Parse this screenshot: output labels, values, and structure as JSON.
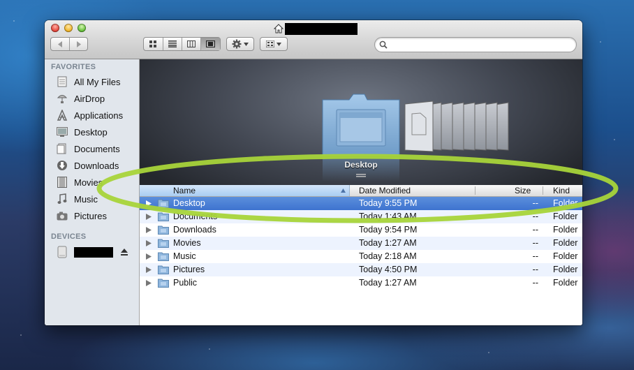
{
  "window": {
    "title": ""
  },
  "toolbar": {
    "view_icons": "icon-view-icon",
    "view_list": "list-view-icon",
    "view_columns": "column-view-icon",
    "view_coverflow": "coverflow-view-icon",
    "action_menu": "gear-icon",
    "arrange_menu": "arrange-icon"
  },
  "search": {
    "value": "",
    "placeholder": ""
  },
  "sidebar": {
    "favorites_heading": "FAVORITES",
    "favorites": [
      {
        "label": "All My Files",
        "icon": "all-files-icon"
      },
      {
        "label": "AirDrop",
        "icon": "airdrop-icon"
      },
      {
        "label": "Applications",
        "icon": "applications-icon"
      },
      {
        "label": "Desktop",
        "icon": "desktop-icon"
      },
      {
        "label": "Documents",
        "icon": "documents-icon"
      },
      {
        "label": "Downloads",
        "icon": "downloads-icon"
      },
      {
        "label": "Movies",
        "icon": "movies-icon"
      },
      {
        "label": "Music",
        "icon": "music-icon"
      },
      {
        "label": "Pictures",
        "icon": "pictures-icon"
      }
    ],
    "devices_heading": "DEVICES"
  },
  "coverflow": {
    "current_label": "Desktop"
  },
  "list": {
    "columns": {
      "name": "Name",
      "date": "Date Modified",
      "size": "Size",
      "kind": "Kind"
    },
    "rows": [
      {
        "name": "Desktop",
        "date": "Today 9:55 PM",
        "size": "--",
        "kind": "Folder",
        "selected": true
      },
      {
        "name": "Documents",
        "date": "Today 1:43 AM",
        "size": "--",
        "kind": "Folder"
      },
      {
        "name": "Downloads",
        "date": "Today 9:54 PM",
        "size": "--",
        "kind": "Folder"
      },
      {
        "name": "Movies",
        "date": "Today 1:27 AM",
        "size": "--",
        "kind": "Folder"
      },
      {
        "name": "Music",
        "date": "Today 2:18 AM",
        "size": "--",
        "kind": "Folder"
      },
      {
        "name": "Pictures",
        "date": "Today 4:50 PM",
        "size": "--",
        "kind": "Folder"
      },
      {
        "name": "Public",
        "date": "Today 1:27 AM",
        "size": "--",
        "kind": "Folder"
      }
    ]
  },
  "colors": {
    "selection": "#3e73cf",
    "annotation": "#a8d43a",
    "alt_row": "#edf3fe"
  }
}
